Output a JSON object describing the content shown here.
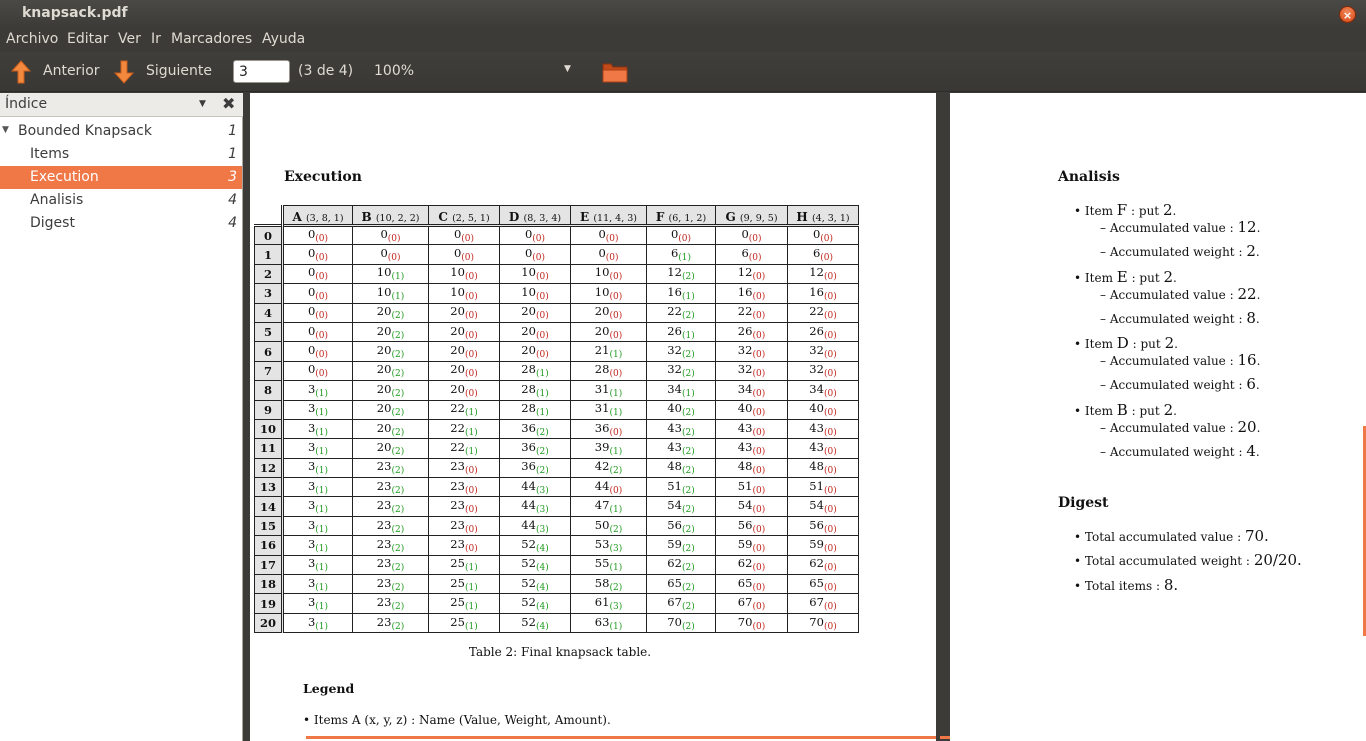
{
  "window": {
    "title": "knapsack.pdf",
    "close_icon": "×"
  },
  "menu": [
    "Archivo",
    "Editar",
    "Ver",
    "Ir",
    "Marcadores",
    "Ayuda"
  ],
  "toolbar": {
    "prev_label": "Anterior",
    "next_label": "Siguiente",
    "page_value": "3",
    "page_count": "(3 de 4)",
    "zoom": "100%"
  },
  "sidebar": {
    "title": "Índice",
    "items": [
      {
        "label": "Bounded Knapsack",
        "page": "1"
      },
      {
        "label": "Items",
        "page": "1"
      },
      {
        "label": "Execution",
        "page": "3"
      },
      {
        "label": "Analisis",
        "page": "4"
      },
      {
        "label": "Digest",
        "page": "4"
      }
    ]
  },
  "colors": {
    "accent": "#f07746",
    "green": "#1f9a1f",
    "red": "#c2251f"
  },
  "page3": {
    "section_title": "Execution",
    "columns": [
      {
        "name": "A",
        "params": "(3, 8, 1)"
      },
      {
        "name": "B",
        "params": "(10, 2, 2)"
      },
      {
        "name": "C",
        "params": "(2, 5, 1)"
      },
      {
        "name": "D",
        "params": "(8, 3, 4)"
      },
      {
        "name": "E",
        "params": "(11, 4, 3)"
      },
      {
        "name": "F",
        "params": "(6, 1, 2)"
      },
      {
        "name": "G",
        "params": "(9, 9, 5)"
      },
      {
        "name": "H",
        "params": "(4, 3, 1)"
      }
    ],
    "rows": [
      {
        "idx": "0",
        "cells": [
          [
            "0",
            "0"
          ],
          [
            "0",
            "0"
          ],
          [
            "0",
            "0"
          ],
          [
            "0",
            "0"
          ],
          [
            "0",
            "0"
          ],
          [
            "0",
            "0"
          ],
          [
            "0",
            "0"
          ],
          [
            "0",
            "0"
          ]
        ]
      },
      {
        "idx": "1",
        "cells": [
          [
            "0",
            "0"
          ],
          [
            "0",
            "0"
          ],
          [
            "0",
            "0"
          ],
          [
            "0",
            "0"
          ],
          [
            "0",
            "0"
          ],
          [
            "6",
            "1"
          ],
          [
            "6",
            "0"
          ],
          [
            "6",
            "0"
          ]
        ]
      },
      {
        "idx": "2",
        "cells": [
          [
            "0",
            "0"
          ],
          [
            "10",
            "1"
          ],
          [
            "10",
            "0"
          ],
          [
            "10",
            "0"
          ],
          [
            "10",
            "0"
          ],
          [
            "12",
            "2"
          ],
          [
            "12",
            "0"
          ],
          [
            "12",
            "0"
          ]
        ]
      },
      {
        "idx": "3",
        "cells": [
          [
            "0",
            "0"
          ],
          [
            "10",
            "1"
          ],
          [
            "10",
            "0"
          ],
          [
            "10",
            "0"
          ],
          [
            "10",
            "0"
          ],
          [
            "16",
            "1"
          ],
          [
            "16",
            "0"
          ],
          [
            "16",
            "0"
          ]
        ]
      },
      {
        "idx": "4",
        "cells": [
          [
            "0",
            "0"
          ],
          [
            "20",
            "2"
          ],
          [
            "20",
            "0"
          ],
          [
            "20",
            "0"
          ],
          [
            "20",
            "0"
          ],
          [
            "22",
            "2"
          ],
          [
            "22",
            "0"
          ],
          [
            "22",
            "0"
          ]
        ]
      },
      {
        "idx": "5",
        "cells": [
          [
            "0",
            "0"
          ],
          [
            "20",
            "2"
          ],
          [
            "20",
            "0"
          ],
          [
            "20",
            "0"
          ],
          [
            "20",
            "0"
          ],
          [
            "26",
            "1"
          ],
          [
            "26",
            "0"
          ],
          [
            "26",
            "0"
          ]
        ]
      },
      {
        "idx": "6",
        "cells": [
          [
            "0",
            "0"
          ],
          [
            "20",
            "2"
          ],
          [
            "20",
            "0"
          ],
          [
            "20",
            "0"
          ],
          [
            "21",
            "1"
          ],
          [
            "32",
            "2"
          ],
          [
            "32",
            "0"
          ],
          [
            "32",
            "0"
          ]
        ]
      },
      {
        "idx": "7",
        "cells": [
          [
            "0",
            "0"
          ],
          [
            "20",
            "2"
          ],
          [
            "20",
            "0"
          ],
          [
            "28",
            "1"
          ],
          [
            "28",
            "0"
          ],
          [
            "32",
            "2"
          ],
          [
            "32",
            "0"
          ],
          [
            "32",
            "0"
          ]
        ]
      },
      {
        "idx": "8",
        "cells": [
          [
            "3",
            "1"
          ],
          [
            "20",
            "2"
          ],
          [
            "20",
            "0"
          ],
          [
            "28",
            "1"
          ],
          [
            "31",
            "1"
          ],
          [
            "34",
            "1"
          ],
          [
            "34",
            "0"
          ],
          [
            "34",
            "0"
          ]
        ]
      },
      {
        "idx": "9",
        "cells": [
          [
            "3",
            "1"
          ],
          [
            "20",
            "2"
          ],
          [
            "22",
            "1"
          ],
          [
            "28",
            "1"
          ],
          [
            "31",
            "1"
          ],
          [
            "40",
            "2"
          ],
          [
            "40",
            "0"
          ],
          [
            "40",
            "0"
          ]
        ]
      },
      {
        "idx": "10",
        "cells": [
          [
            "3",
            "1"
          ],
          [
            "20",
            "2"
          ],
          [
            "22",
            "1"
          ],
          [
            "36",
            "2"
          ],
          [
            "36",
            "0"
          ],
          [
            "43",
            "2"
          ],
          [
            "43",
            "0"
          ],
          [
            "43",
            "0"
          ]
        ]
      },
      {
        "idx": "11",
        "cells": [
          [
            "3",
            "1"
          ],
          [
            "20",
            "2"
          ],
          [
            "22",
            "1"
          ],
          [
            "36",
            "2"
          ],
          [
            "39",
            "1"
          ],
          [
            "43",
            "2"
          ],
          [
            "43",
            "0"
          ],
          [
            "43",
            "0"
          ]
        ]
      },
      {
        "idx": "12",
        "cells": [
          [
            "3",
            "1"
          ],
          [
            "23",
            "2"
          ],
          [
            "23",
            "0"
          ],
          [
            "36",
            "2"
          ],
          [
            "42",
            "2"
          ],
          [
            "48",
            "2"
          ],
          [
            "48",
            "0"
          ],
          [
            "48",
            "0"
          ]
        ]
      },
      {
        "idx": "13",
        "cells": [
          [
            "3",
            "1"
          ],
          [
            "23",
            "2"
          ],
          [
            "23",
            "0"
          ],
          [
            "44",
            "3"
          ],
          [
            "44",
            "0"
          ],
          [
            "51",
            "2"
          ],
          [
            "51",
            "0"
          ],
          [
            "51",
            "0"
          ]
        ]
      },
      {
        "idx": "14",
        "cells": [
          [
            "3",
            "1"
          ],
          [
            "23",
            "2"
          ],
          [
            "23",
            "0"
          ],
          [
            "44",
            "3"
          ],
          [
            "47",
            "1"
          ],
          [
            "54",
            "2"
          ],
          [
            "54",
            "0"
          ],
          [
            "54",
            "0"
          ]
        ]
      },
      {
        "idx": "15",
        "cells": [
          [
            "3",
            "1"
          ],
          [
            "23",
            "2"
          ],
          [
            "23",
            "0"
          ],
          [
            "44",
            "3"
          ],
          [
            "50",
            "2"
          ],
          [
            "56",
            "2"
          ],
          [
            "56",
            "0"
          ],
          [
            "56",
            "0"
          ]
        ]
      },
      {
        "idx": "16",
        "cells": [
          [
            "3",
            "1"
          ],
          [
            "23",
            "2"
          ],
          [
            "23",
            "0"
          ],
          [
            "52",
            "4"
          ],
          [
            "53",
            "3"
          ],
          [
            "59",
            "2"
          ],
          [
            "59",
            "0"
          ],
          [
            "59",
            "0"
          ]
        ]
      },
      {
        "idx": "17",
        "cells": [
          [
            "3",
            "1"
          ],
          [
            "23",
            "2"
          ],
          [
            "25",
            "1"
          ],
          [
            "52",
            "4"
          ],
          [
            "55",
            "1"
          ],
          [
            "62",
            "2"
          ],
          [
            "62",
            "0"
          ],
          [
            "62",
            "0"
          ]
        ]
      },
      {
        "idx": "18",
        "cells": [
          [
            "3",
            "1"
          ],
          [
            "23",
            "2"
          ],
          [
            "25",
            "1"
          ],
          [
            "52",
            "4"
          ],
          [
            "58",
            "2"
          ],
          [
            "65",
            "2"
          ],
          [
            "65",
            "0"
          ],
          [
            "65",
            "0"
          ]
        ]
      },
      {
        "idx": "19",
        "cells": [
          [
            "3",
            "1"
          ],
          [
            "23",
            "2"
          ],
          [
            "25",
            "1"
          ],
          [
            "52",
            "4"
          ],
          [
            "61",
            "3"
          ],
          [
            "67",
            "2"
          ],
          [
            "67",
            "0"
          ],
          [
            "67",
            "0"
          ]
        ]
      },
      {
        "idx": "20",
        "cells": [
          [
            "3",
            "1"
          ],
          [
            "23",
            "2"
          ],
          [
            "25",
            "1"
          ],
          [
            "52",
            "4"
          ],
          [
            "63",
            "1"
          ],
          [
            "70",
            "2"
          ],
          [
            "70",
            "0"
          ],
          [
            "70",
            "0"
          ]
        ]
      }
    ],
    "caption": "Table 2: Final knapsack table.",
    "legend_title": "Legend",
    "legend_item": "• Items A (x, y, z) : Name (Value, Weight, Amount)."
  },
  "page4": {
    "analisis_title": "Analisis",
    "items": [
      {
        "item": "F",
        "put": "2",
        "value": "12",
        "weight": "2"
      },
      {
        "item": "E",
        "put": "2",
        "value": "22",
        "weight": "8"
      },
      {
        "item": "D",
        "put": "2",
        "value": "16",
        "weight": "6"
      },
      {
        "item": "B",
        "put": "2",
        "value": "20",
        "weight": "4"
      }
    ],
    "labels": {
      "item": "Item",
      "put": ": put",
      "acc_value": "Accumulated value :",
      "acc_weight": "Accumulated weight :"
    },
    "digest_title": "Digest",
    "digest": [
      {
        "label": "Total accumulated value :",
        "value": "70."
      },
      {
        "label": "Total accumulated weight :",
        "value": "20/20."
      },
      {
        "label": "Total items :",
        "value": "8."
      }
    ]
  }
}
